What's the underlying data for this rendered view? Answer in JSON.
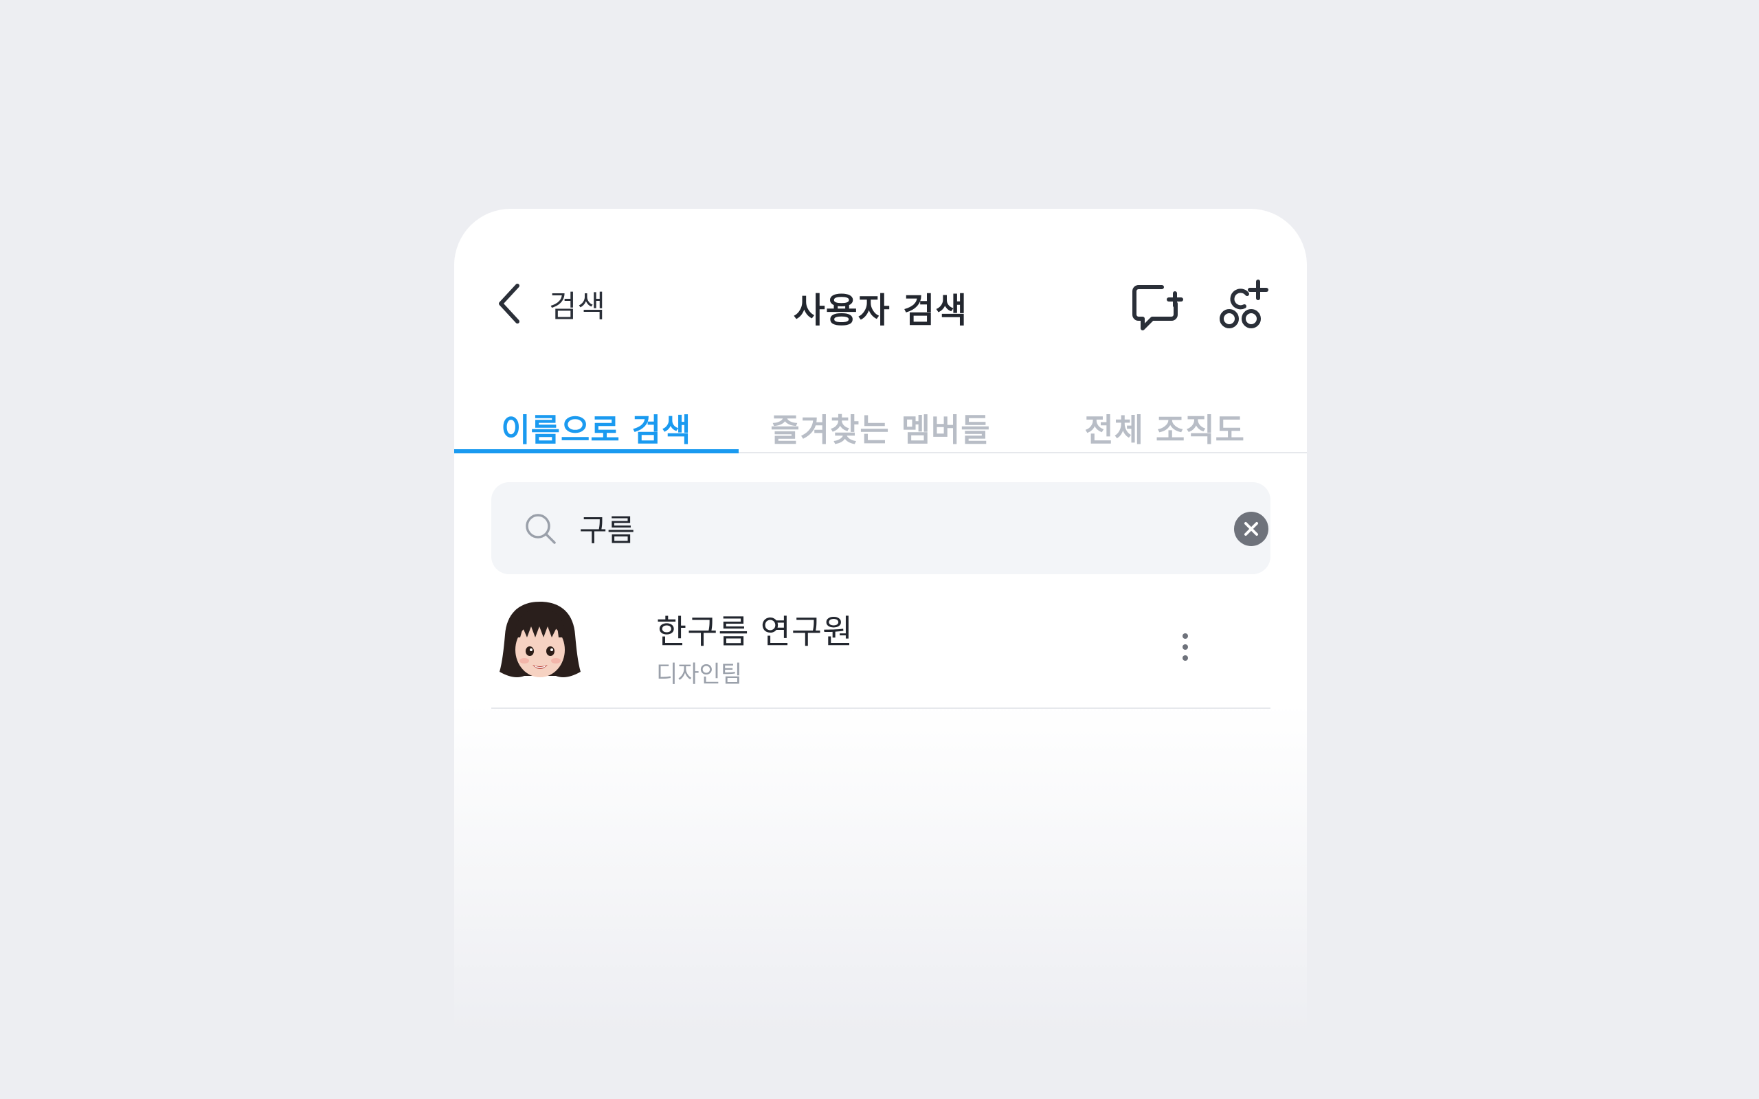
{
  "header": {
    "back_label": "검색",
    "title": "사용자 검색",
    "icons": {
      "back": "chevron-left-icon",
      "new_chat": "chat-bubble-plus-icon",
      "add_user": "add-group-icon"
    }
  },
  "tabs": [
    {
      "label": "이름으로 검색",
      "active": true
    },
    {
      "label": "즐겨찾는 멤버들",
      "active": false
    },
    {
      "label": "전체 조직도",
      "active": false
    }
  ],
  "search": {
    "value": "구름",
    "placeholder": ""
  },
  "results": [
    {
      "name": "한구름 연구원",
      "department": "디자인팀"
    }
  ],
  "colors": {
    "accent": "#1a9af0",
    "background": "#edeef2",
    "inactive_tab": "#b8bdc6",
    "text_primary": "#22262e",
    "text_secondary": "#9aa0aa"
  }
}
